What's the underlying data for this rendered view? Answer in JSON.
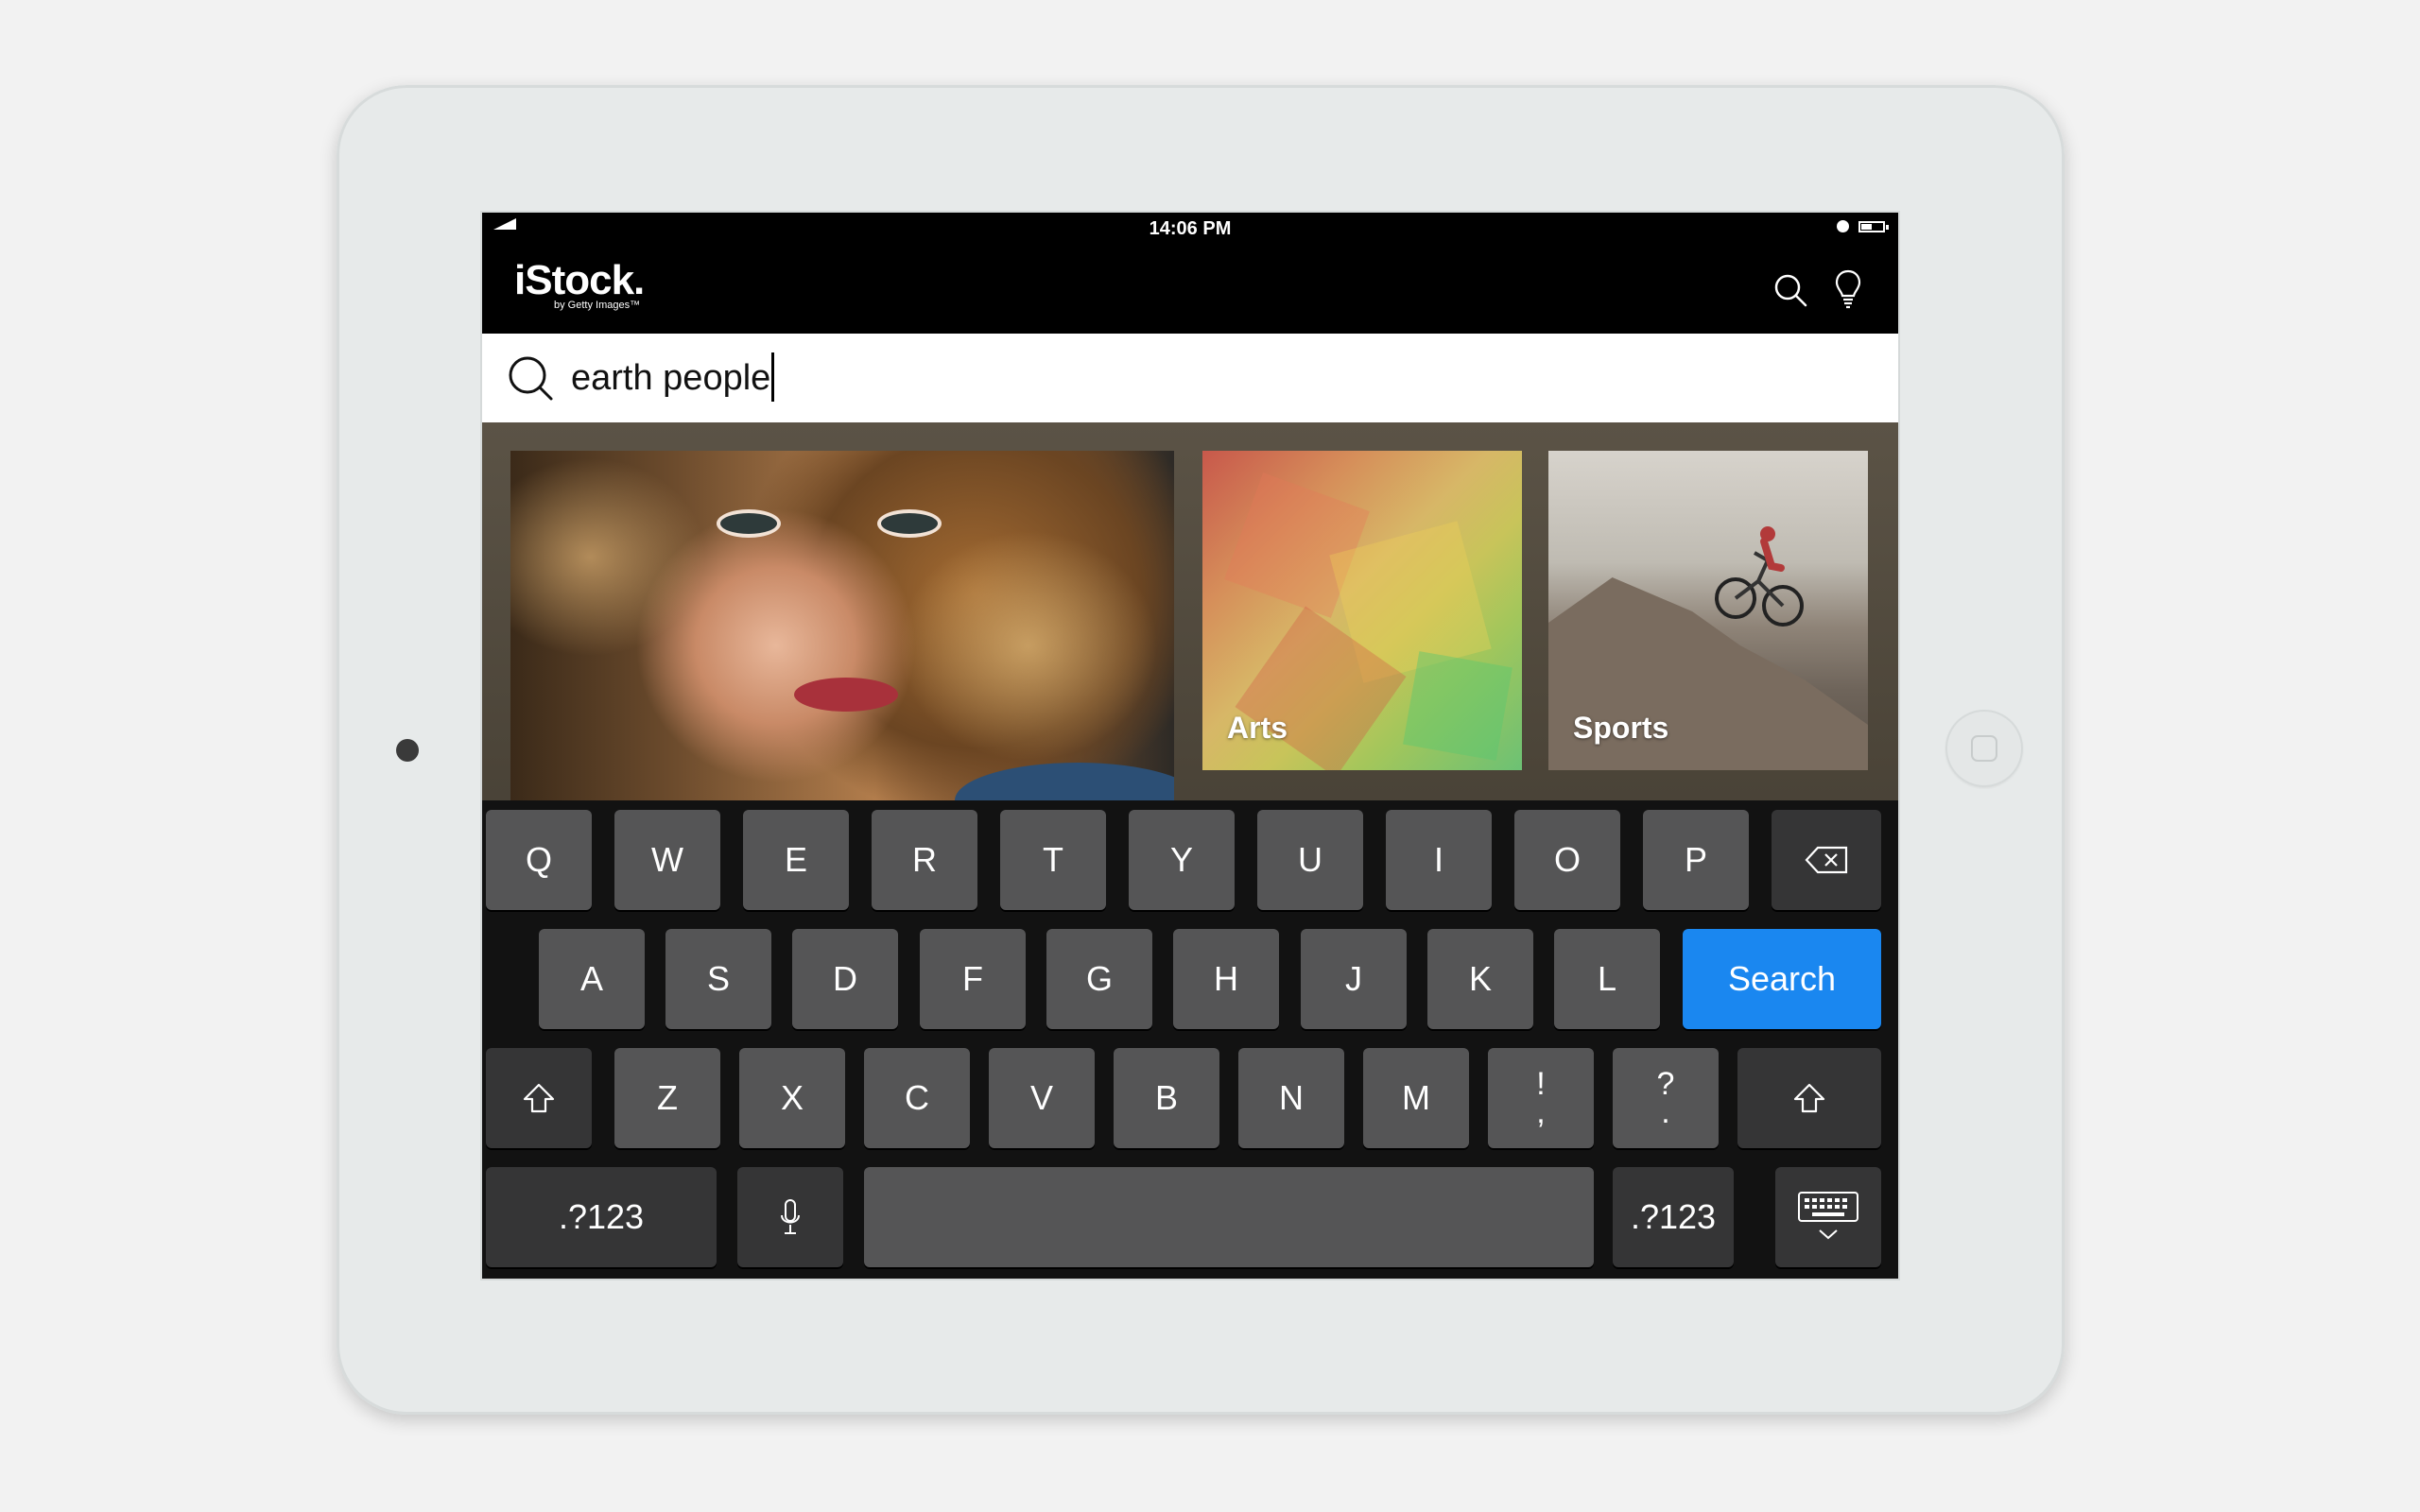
{
  "status_bar": {
    "time": "14:06 PM"
  },
  "app": {
    "logo": "iStock.",
    "logo_sub": "by Getty Images™"
  },
  "search": {
    "query": "earth people"
  },
  "gallery": {
    "tiles": [
      {
        "label": ""
      },
      {
        "label": "Arts"
      },
      {
        "label": "Sports"
      }
    ]
  },
  "keyboard": {
    "row1": [
      "Q",
      "W",
      "E",
      "R",
      "T",
      "Y",
      "U",
      "I",
      "O",
      "P"
    ],
    "row2": [
      "A",
      "S",
      "D",
      "F",
      "G",
      "H",
      "J",
      "K",
      "L"
    ],
    "row3": [
      "Z",
      "X",
      "C",
      "V",
      "B",
      "N",
      "M"
    ],
    "punct1": {
      "top": "!",
      "bottom": ","
    },
    "punct2": {
      "top": "?",
      "bottom": "."
    },
    "search_label": "Search",
    "numbers_label": ".?123",
    "accent_color": "#1a87f0"
  }
}
